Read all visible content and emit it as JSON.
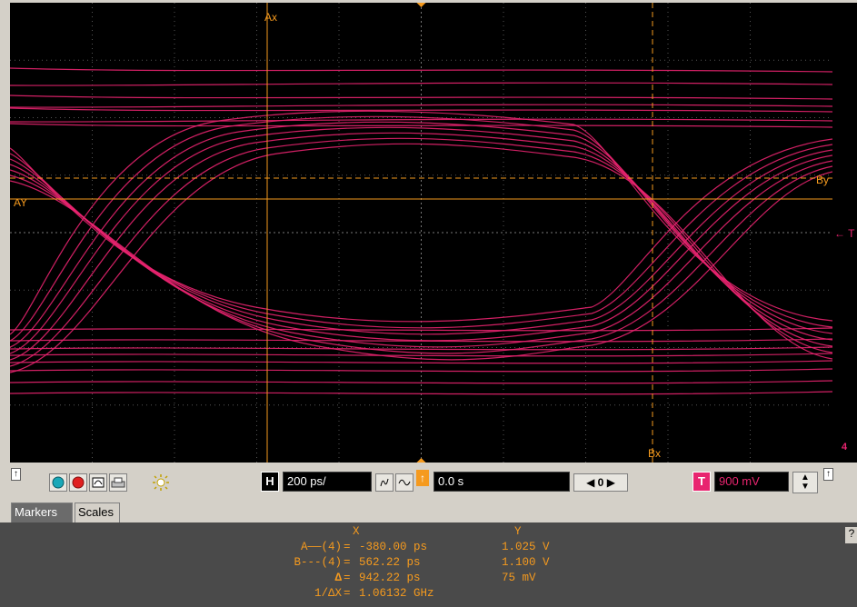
{
  "screen": {
    "marker_labels": {
      "ax": "Ax",
      "bx": "Bx",
      "ay": "AY",
      "by": "By"
    },
    "trigger_level_marker": "← T",
    "channel_ground_marker": "4"
  },
  "controls": {
    "timebase_label": "H",
    "timebase_value": "200 ps/",
    "delay_value": "0.0 s",
    "nav_value": "0",
    "trigger_label": "T",
    "trigger_value": "900 mV",
    "colors": {
      "trace": "#e8246f",
      "markers": "#f59a1e",
      "grid": "#555555"
    }
  },
  "tabs": [
    {
      "label": "Markers",
      "active": true
    },
    {
      "label": "Scales",
      "active": false
    }
  ],
  "readout": {
    "col_x_header": "X",
    "col_y_header": "Y",
    "rows": [
      {
        "label": "A——(4)",
        "x": "-380.00 ps",
        "y": "1.025 V"
      },
      {
        "label": "B---(4)",
        "x": "562.22 ps",
        "y": "1.100 V"
      },
      {
        "label": "Δ",
        "x": "942.22 ps",
        "y": "75 mV"
      },
      {
        "label": "1/ΔX",
        "x": "1.06132 GHz",
        "y": ""
      }
    ],
    "help": "?"
  }
}
